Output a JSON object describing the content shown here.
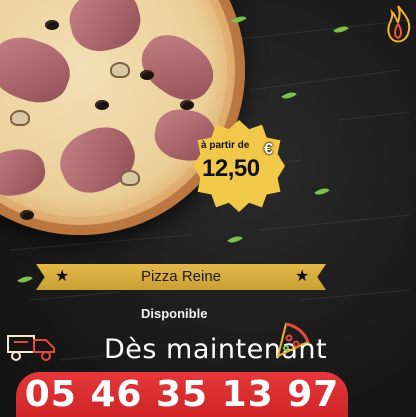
{
  "price": {
    "from_label": "à partir de",
    "amount": "12,50",
    "currency": "€"
  },
  "pizza_name": "Pizza Reine",
  "availability": {
    "label": "Disponible",
    "subtitle": "Dès maintenant"
  },
  "contact": {
    "phone": "05 46 35 13 97"
  },
  "icons": {
    "top_right": "flame-pepper-neon-icon",
    "left": "delivery-truck-neon-icon",
    "right": "pizza-slice-neon-icon",
    "ribbon_stars": "star-icon"
  },
  "colors": {
    "background": "#1b1b1b",
    "badge": "#f2c84a",
    "ribbon": "#d6ac3f",
    "phone_bar": "#d8292c",
    "leaf": "#7cc24a"
  }
}
